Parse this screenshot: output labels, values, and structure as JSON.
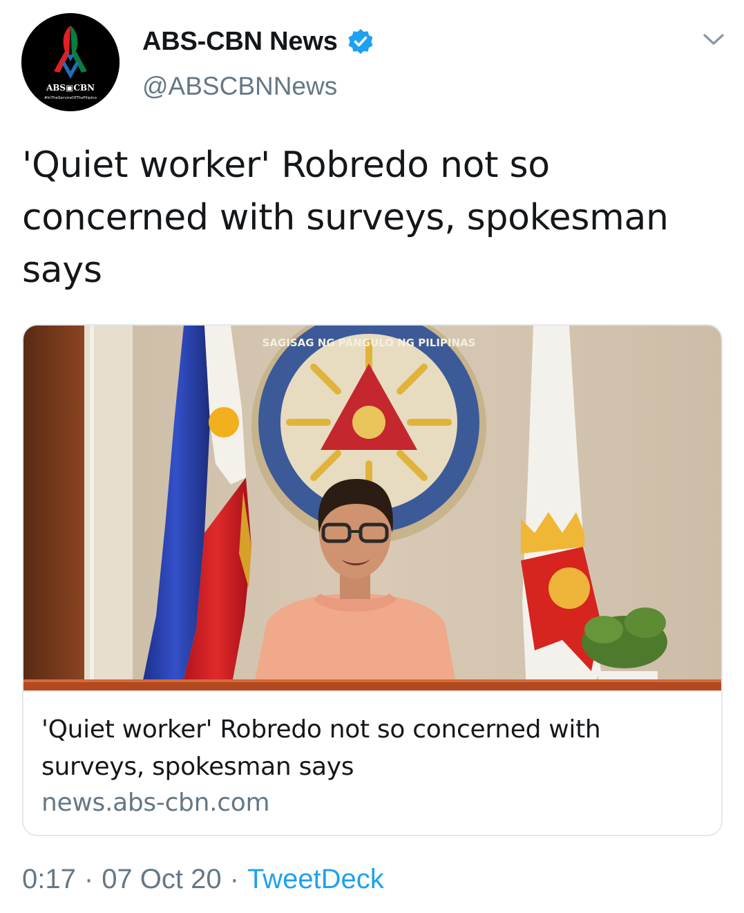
{
  "tweet": {
    "author": {
      "display_name": "ABS-CBN News",
      "handle": "@ABSCBNNews",
      "verified": true,
      "avatar_logo_text": "ABS-CBN",
      "avatar_tagline": "#InTheServiceOfTheFilipino"
    },
    "text_lines": [
      "'Quiet worker' Robredo not so",
      "concerned with surveys, spokesman",
      "says"
    ],
    "card": {
      "title_lines": [
        "'Quiet worker' Robredo not so concerned with",
        "surveys, spokesman says"
      ],
      "domain": "news.abs-cbn.com",
      "image_seal_text": "SAGISAG NG PANGULO NG PILIPINAS"
    },
    "meta": {
      "time": "0:17",
      "date": "07 Oct 20",
      "separator": "·",
      "source": "TweetDeck"
    },
    "colors": {
      "text_primary": "#14171a",
      "text_secondary": "#657786",
      "link_blue": "#1da1f2",
      "verified_blue": "#1da1f2",
      "border": "#e1e8ed"
    },
    "icons": {
      "verified": "verified-badge-icon",
      "caret": "chevron-down-icon"
    }
  }
}
